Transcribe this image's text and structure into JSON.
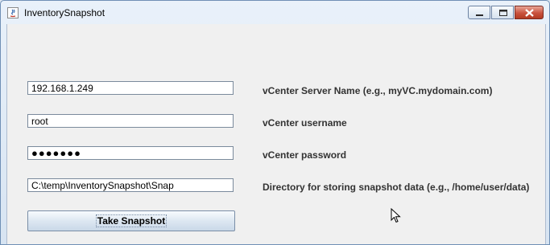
{
  "window": {
    "title": "InventorySnapshot",
    "controls": [
      "minimize-icon",
      "maximize-icon",
      "close-icon"
    ]
  },
  "form": {
    "server": {
      "value": "192.168.1.249",
      "label": "vCenter Server Name (e.g., myVC.mydomain.com)"
    },
    "username": {
      "value": "root",
      "label": "vCenter username"
    },
    "password": {
      "value": "●●●●●●●",
      "label": "vCenter password"
    },
    "directory": {
      "value": "C:\\temp\\InventorySnapshot\\Snap",
      "label": "Directory for storing snapshot data (e.g., /home/user/data)"
    },
    "submit_label": "Take Snapshot"
  },
  "colors": {
    "window_border": "#6f8fb5",
    "content_bg": "#f0f0f0",
    "close_button": "#c9523e",
    "label_text": "#333333"
  }
}
